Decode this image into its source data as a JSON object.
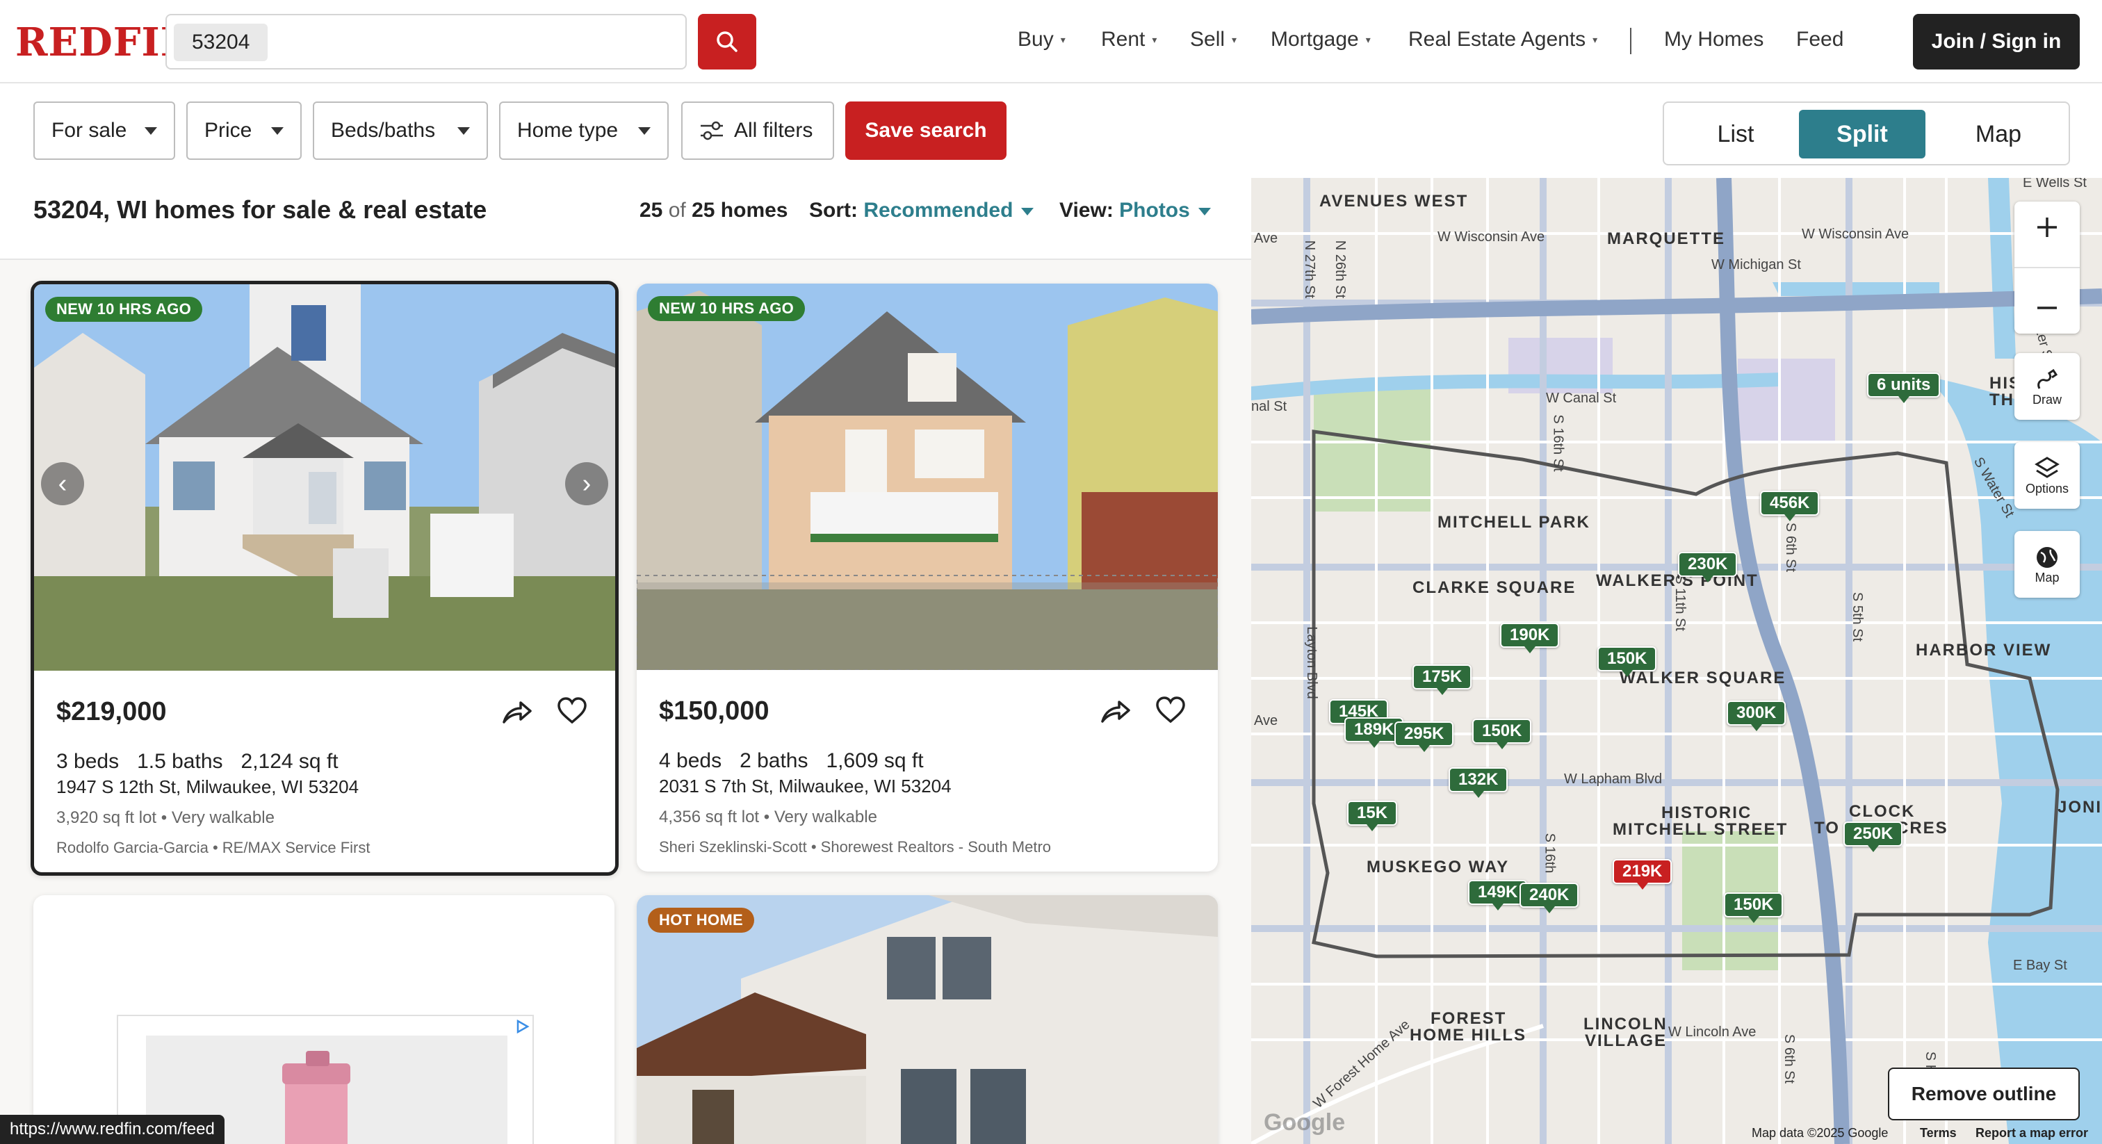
{
  "header": {
    "logo": "REDFIN",
    "search_value": "53204",
    "nav": [
      {
        "label": "Buy",
        "caret": "▾"
      },
      {
        "label": "Rent",
        "caret": "▾"
      },
      {
        "label": "Sell",
        "caret": "▾"
      },
      {
        "label": "Mortgage",
        "caret": "▾"
      },
      {
        "label": "Real Estate Agents",
        "caret": "▾"
      }
    ],
    "my_homes": "My Homes",
    "feed": "Feed",
    "join": "Join / Sign in"
  },
  "filters": {
    "for_sale": "For sale",
    "price": "Price",
    "beds_baths": "Beds/baths",
    "home_type": "Home type",
    "all_filters": "All filters",
    "save_search": "Save search"
  },
  "view_toggle": {
    "list": "List",
    "split": "Split",
    "map": "Map",
    "active": "Split"
  },
  "results": {
    "title": "53204, WI homes for sale & real estate",
    "count": "25",
    "of": "of",
    "total": "25 homes",
    "sort_label": "Sort:",
    "sort_value": "Recommended",
    "view_label": "View:",
    "view_value": "Photos"
  },
  "listings": [
    {
      "badge": "NEW 10 HRS AGO",
      "price": "$219,000",
      "beds": "3 beds",
      "baths": "1.5 baths",
      "sqft": "2,124 sq ft",
      "address": "1947 S 12th St, Milwaukee, WI 53204",
      "lot": "3,920 sq ft lot • Very walkable",
      "agent": "Rodolfo Garcia-Garcia • RE/MAX Service First"
    },
    {
      "badge": "NEW 10 HRS AGO",
      "price": "$150,000",
      "beds": "4 beds",
      "baths": "2 baths",
      "sqft": "1,609 sq ft",
      "address": "2031 S 7th St, Milwaukee, WI 53204",
      "lot": "4,356 sq ft lot • Very walkable",
      "agent": "Sheri Szeklinski-Scott • Shorewest Realtors - South Metro"
    },
    {
      "badge": "HOT HOME"
    }
  ],
  "map": {
    "neighborhoods": [
      "AVENUES WEST",
      "MARQUETTE",
      "MITCHELL PARK",
      "CLARKE SQUARE",
      "WALKER'S POINT",
      "WALKER SQUARE",
      "HARBOR VIEW",
      "HISTORIC",
      "MITCHELL STREET",
      "MUSKEGO WAY",
      "CLOCK",
      "TO",
      "CRES",
      "FOREST",
      "HOME HILLS",
      "LINCOLN",
      "VILLAGE",
      "HIS",
      "THIR",
      "JONI"
    ],
    "streets": [
      "W Wisconsin Ave",
      "W Wisconsin Ave",
      "W Michigan St",
      "W Canal St",
      "W Lapham Blvd",
      "W Lincoln Ave",
      "E Bay St",
      "E Wells St",
      "S 16th St",
      "S 11th St",
      "S 6th St",
      "S 5th St",
      "N 27th St",
      "N 26th St",
      "Layton Blvd",
      "S 16th",
      "W Forest Home Ave",
      "S Water St",
      "Ave",
      "Ave",
      "nal St",
      "ater St",
      "S 6th St",
      "S H"
    ],
    "pins": [
      "6 units",
      "456K",
      "230K",
      "190K",
      "150K",
      "175K",
      "145K",
      "189K",
      "295K",
      "150K",
      "300K",
      "132K",
      "15K",
      "250K",
      "219K",
      "149K",
      "240K",
      "150K"
    ],
    "controls": {
      "draw": "Draw",
      "options": "Options",
      "map": "Map"
    },
    "remove_outline": "Remove outline",
    "footer": {
      "google": "Google",
      "data": "Map data ©2025 Google",
      "terms": "Terms",
      "report": "Report a map error"
    }
  },
  "status_url": "https://www.redfin.com/feed",
  "colors": {
    "brand_red": "#c82021",
    "accent_teal": "#2d7e8c",
    "pin_green": "#2e6b3b"
  }
}
